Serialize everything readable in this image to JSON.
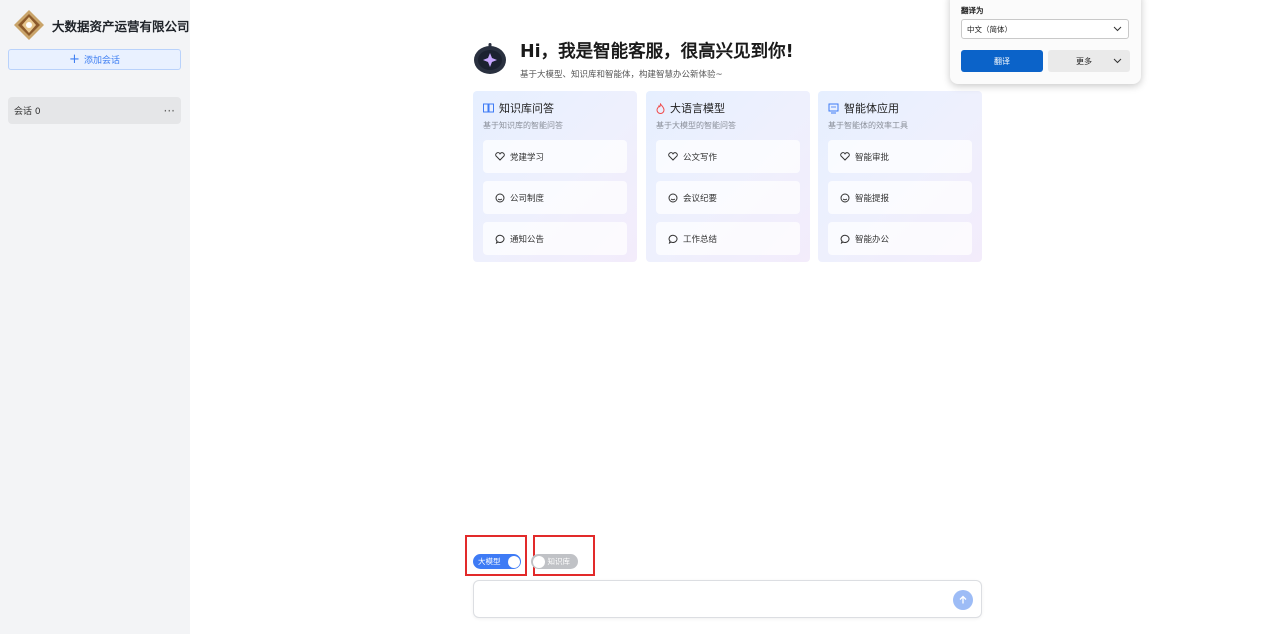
{
  "sidebar": {
    "brand_name": "大数据资产运营有限公司",
    "add_chat_label": "添加会话",
    "sessions": [
      {
        "label": "会话 0",
        "more": "···"
      }
    ]
  },
  "hero": {
    "title": "Hi，我是智能客服，很高兴见到你!",
    "subtitle": "基于大模型、知识库和智能体，构建智慧办公新体验~"
  },
  "cards": [
    {
      "icon": "book-icon",
      "title": "知识库问答",
      "subtitle": "基于知识库的智能问答",
      "items": [
        {
          "icon": "heart-icon",
          "label": "党建学习"
        },
        {
          "icon": "smile-icon",
          "label": "公司制度"
        },
        {
          "icon": "chat-icon",
          "label": "通知公告"
        }
      ]
    },
    {
      "icon": "flame-icon",
      "title": "大语言模型",
      "subtitle": "基于大模型的智能问答",
      "items": [
        {
          "icon": "heart-icon",
          "label": "公文写作"
        },
        {
          "icon": "smile-icon",
          "label": "会议纪要"
        },
        {
          "icon": "chat-icon",
          "label": "工作总结"
        }
      ]
    },
    {
      "icon": "agent-icon",
      "title": "智能体应用",
      "subtitle": "基于智能体的效率工具",
      "items": [
        {
          "icon": "heart-icon",
          "label": "智能审批"
        },
        {
          "icon": "smile-icon",
          "label": "智能提报"
        },
        {
          "icon": "chat-icon",
          "label": "智能办公"
        }
      ]
    }
  ],
  "translate_popup": {
    "label": "翻译为",
    "language": "中文（简体）",
    "translate_button": "翻译",
    "more_button": "更多"
  },
  "toggles": {
    "model": {
      "label": "大模型",
      "on": true
    },
    "knowledge": {
      "label": "知识库",
      "on": false
    }
  },
  "composer": {
    "placeholder": "",
    "value": ""
  },
  "colors": {
    "accent": "#3e7bf5",
    "highlight_box": "#e22a2a",
    "translate_button": "#0b63c9"
  }
}
